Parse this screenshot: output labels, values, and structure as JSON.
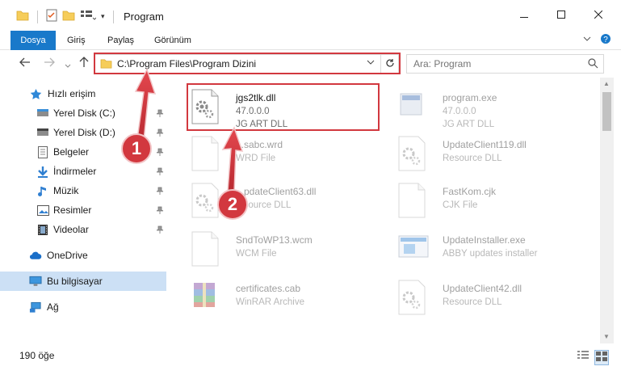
{
  "window": {
    "title": "Program",
    "minimize_icon": "minimize-icon",
    "maximize_icon": "maximize-icon",
    "close_icon": "close-icon"
  },
  "ribbon": {
    "tabs": [
      "Dosya",
      "Giriş",
      "Paylaş",
      "Görünüm"
    ]
  },
  "address": {
    "path": "C:\\Program Files\\Program Dizini",
    "search_placeholder": "Ara: Program"
  },
  "nav": {
    "items": [
      {
        "label": "Hızlı erişim",
        "icon": "star-icon"
      },
      {
        "label": "Yerel Disk (C:)",
        "icon": "drive-icon"
      },
      {
        "label": "Yerel Disk (D:)",
        "icon": "drive-icon"
      },
      {
        "label": "Belgeler",
        "icon": "document-icon"
      },
      {
        "label": "İndirmeler",
        "icon": "download-icon"
      },
      {
        "label": "Müzik",
        "icon": "music-icon"
      },
      {
        "label": "Resimler",
        "icon": "pictures-icon"
      },
      {
        "label": "Videolar",
        "icon": "video-icon"
      },
      {
        "label": "OneDrive",
        "icon": "cloud-icon"
      },
      {
        "label": "Bu bilgisayar",
        "icon": "computer-icon"
      },
      {
        "label": "Ağ",
        "icon": "network-icon"
      }
    ]
  },
  "files": [
    {
      "name": "jgs2tlk.dll",
      "meta1": "47.0.0.0",
      "meta2": "JG ART DLL",
      "icon": "dll-gear-icon"
    },
    {
      "name": "program.exe",
      "meta1": "47.0.0.0",
      "meta2": "JG ART DLL",
      "icon": "exe-icon"
    },
    {
      "name": "...sabc.wrd",
      "meta1": "WRD File",
      "meta2": "",
      "icon": "file-icon"
    },
    {
      "name": "UpdateClient119.dll",
      "meta1": "Resource DLL",
      "meta2": "",
      "icon": "dll-gear-icon"
    },
    {
      "name": "...pdateClient63.dll",
      "meta1": "...source DLL",
      "meta2": "",
      "icon": "dll-gear-icon"
    },
    {
      "name": "FastKom.cjk",
      "meta1": "CJK File",
      "meta2": "",
      "icon": "file-icon"
    },
    {
      "name": "SndToWP13.wcm",
      "meta1": "WCM File",
      "meta2": "",
      "icon": "file-icon"
    },
    {
      "name": "UpdateInstaller.exe",
      "meta1": "ABBY updates installer",
      "meta2": "",
      "icon": "installer-icon"
    },
    {
      "name": "certificates.cab",
      "meta1": "WinRAR Archive",
      "meta2": "",
      "icon": "archive-icon"
    },
    {
      "name": "UpdateClient42.dll",
      "meta1": "Resource DLL",
      "meta2": "",
      "icon": "dll-gear-icon"
    }
  ],
  "status": {
    "count": "190 öğe"
  },
  "annotations": {
    "step1": "1",
    "step2": "2"
  },
  "colors": {
    "accent": "#1979ca",
    "highlight": "#d2383f",
    "selected": "#cce0f5"
  }
}
